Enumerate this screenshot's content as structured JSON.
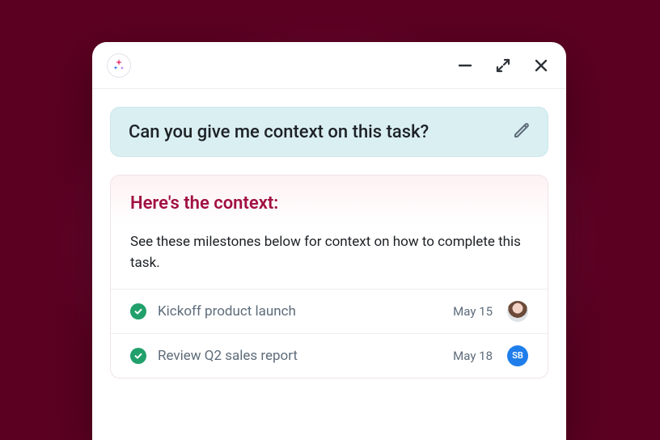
{
  "prompt": {
    "text": "Can you give me context on this task?"
  },
  "response": {
    "title": "Here's the context:",
    "body": "See these milestones below for context on how to complete this task."
  },
  "milestones": [
    {
      "title": "Kickoff product launch",
      "date": "May 15",
      "avatar_type": "photo",
      "avatar_initials": ""
    },
    {
      "title": "Review Q2 sales report",
      "date": "May 18",
      "avatar_type": "initials",
      "avatar_initials": "SB"
    }
  ]
}
